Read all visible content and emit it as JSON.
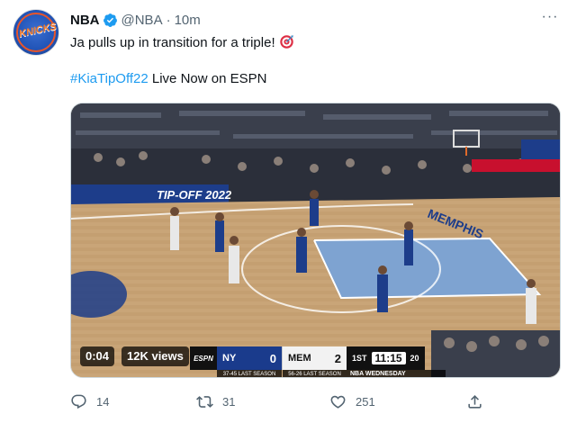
{
  "author": {
    "name": "NBA",
    "handle": "@NBA",
    "time": "10m",
    "avatar_icon": "new-york-knicks-logo"
  },
  "tweet": {
    "text": "Ja pulls up in transition for a triple!",
    "emoji_icon": "direct-hit-target-icon",
    "hashtag": "#KiaTipOff22",
    "line2_rest": " Live Now on ESPN"
  },
  "video": {
    "elapsed": "0:04",
    "views": "12K views",
    "scorebug": {
      "network": "ESPN",
      "team1": "NY",
      "score1": "0",
      "team1_record": "37-45 LAST SEASON",
      "team2": "MEM",
      "score2": "2",
      "team2_record": "56-26 LAST SEASON",
      "quarter": "1ST",
      "clock": "11:15",
      "shot_clock": "20",
      "tag": "NBA WEDNESDAY"
    },
    "court_texts": {
      "banner": "TIP-OFF 2022",
      "baseline": "MEMPHIS"
    }
  },
  "actions": {
    "replies": "14",
    "retweets": "31",
    "likes": "251"
  },
  "colors": {
    "accent": "#1d9bf0",
    "text_secondary": "#536471",
    "verified": "#1d9bf0"
  }
}
